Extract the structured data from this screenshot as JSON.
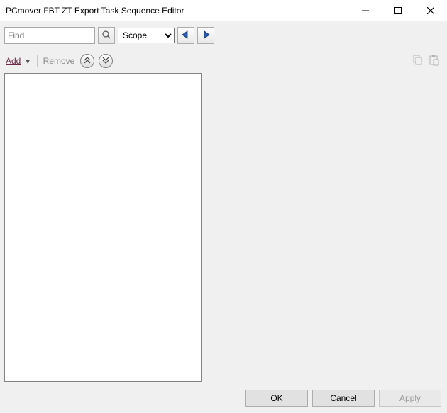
{
  "window": {
    "title": "PCmover FBT ZT Export Task Sequence Editor"
  },
  "toolbar1": {
    "find_placeholder": "Find",
    "scope_label": "Scope"
  },
  "toolbar2": {
    "add_label": "Add",
    "remove_label": "Remove"
  },
  "buttons": {
    "ok": "OK",
    "cancel": "Cancel",
    "apply": "Apply"
  }
}
